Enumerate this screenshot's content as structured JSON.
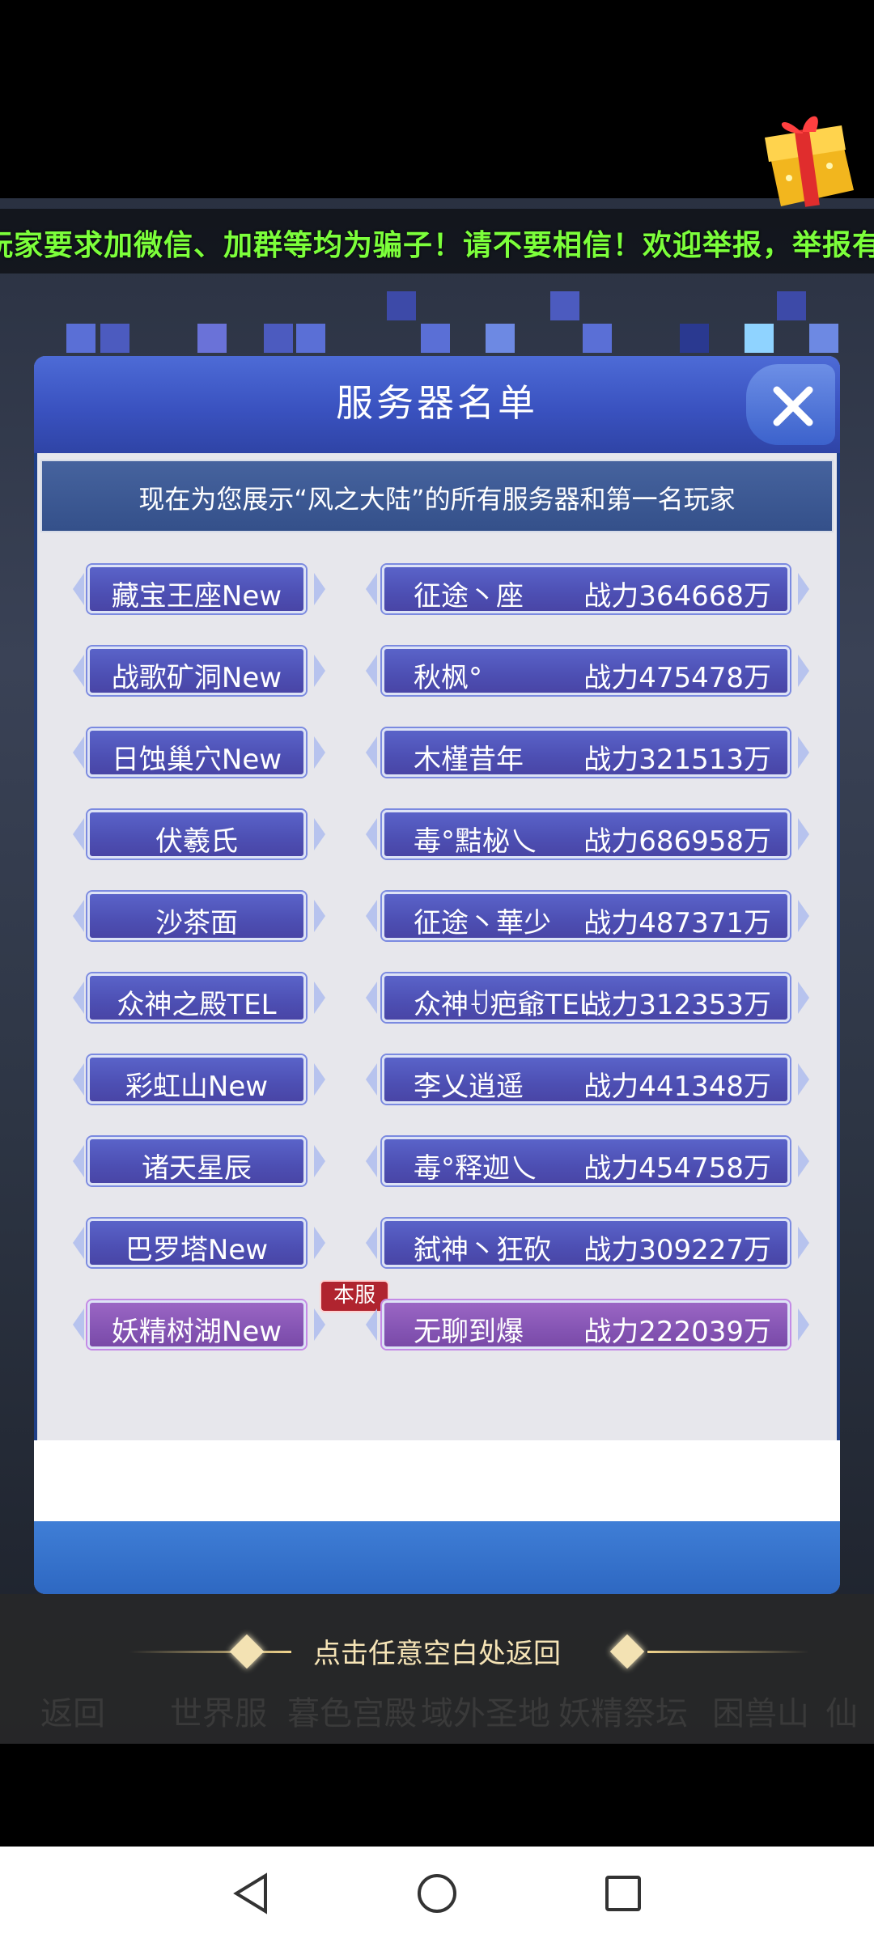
{
  "ticker": {
    "text": "玩家要求加微信、加群等均为骗子！请不要相信！欢迎举报，举报有奖！"
  },
  "dialog": {
    "title": "服务器名单",
    "subtitle": "现在为您展示“风之大陆”的所有服务器和第一名玩家",
    "current_badge": "本服",
    "rows": [
      {
        "server": "藏宝王座New",
        "player": "征途丶座",
        "power": "战力364668万"
      },
      {
        "server": "战歌矿洞New",
        "player": "秋枫°",
        "power": "战力475478万"
      },
      {
        "server": "日蚀巢穴New",
        "player": "木槿昔年",
        "power": "战力321513万"
      },
      {
        "server": "伏羲氏",
        "player": "毒°黠柲乀",
        "power": "战力686958万"
      },
      {
        "server": "沙茶面",
        "player": "征途丶華少",
        "power": "战力487371万"
      },
      {
        "server": "众神之殿TEL",
        "player": "众神ꀀ疤爺TEL",
        "power": "战力312353万"
      },
      {
        "server": "彩虹山New",
        "player": "李乂逍遥",
        "power": "战力441348万"
      },
      {
        "server": "诸天星辰",
        "player": "毒°释迦乀",
        "power": "战力454758万"
      },
      {
        "server": "巴罗塔New",
        "player": "弑神丶狂砍",
        "power": "战力309227万"
      },
      {
        "server": "妖精树湖New",
        "player": "无聊到爆",
        "power": "战力222039万",
        "current": true
      }
    ]
  },
  "hint": "点击任意空白处返回",
  "nav": [
    "返回",
    "世界服",
    "暮色宫殿",
    "域外圣地",
    "妖精祭坛",
    "困兽山",
    "仙"
  ],
  "colors": {
    "ticker": "#7cff3b",
    "pill": "#4d4fb3",
    "current_pill": "#8555b4",
    "badge": "#b0242f"
  }
}
